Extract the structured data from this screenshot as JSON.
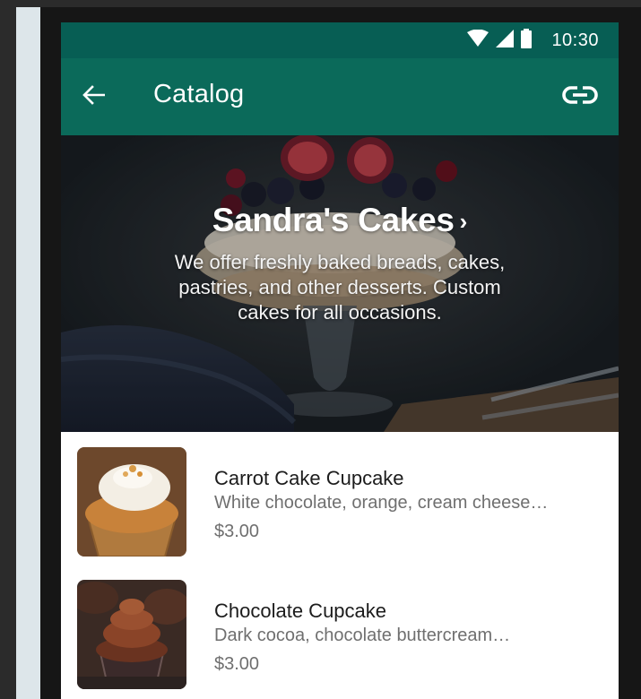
{
  "status_bar": {
    "time": "10:30",
    "icons": [
      "wifi-icon",
      "signal-icon",
      "battery-icon"
    ]
  },
  "app_bar": {
    "title": "Catalog",
    "back_icon": "arrow-back-icon",
    "link_icon": "link-icon"
  },
  "business": {
    "name": "Sandra's Cakes",
    "chevron": "›",
    "description": "We offer freshly baked breads, cakes, pastries, and other desserts. Custom cakes for all occasions."
  },
  "products": [
    {
      "name": "Carrot Cake Cupcake",
      "description": "White chocolate, orange, cream cheese…",
      "price": "$3.00"
    },
    {
      "name": "Chocolate Cupcake",
      "description": "Dark cocoa, chocolate buttercream…",
      "price": "$3.00"
    }
  ],
  "colors": {
    "status_bar": "#075e54",
    "app_bar": "#0b6a5a"
  }
}
